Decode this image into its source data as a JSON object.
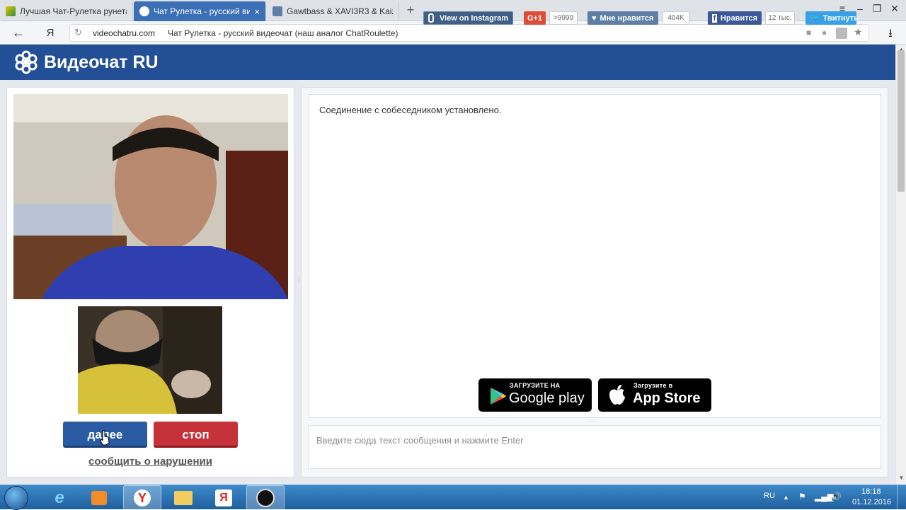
{
  "browser": {
    "tabs": [
      {
        "label": "Лучшая Чат-Рулетка рунета",
        "active": false
      },
      {
        "label": "Чат Рулетка - русский видеочат",
        "active": true
      },
      {
        "label": "Gawtbass & XAVI3R3 & Kaiz",
        "active": false
      }
    ],
    "tab_close": "×",
    "new_tab": "+",
    "address": {
      "domain": "videochatru.com",
      "page_title": "Чат Рулетка - русский видеочат (наш аналог ChatRoulette)"
    }
  },
  "site": {
    "logo_text": "Видеочат RU",
    "social": {
      "instagram": "View on Instagram",
      "gplus": "G+1",
      "gplus_count": ">9999",
      "like": "Мне нравится",
      "like_count": "404K",
      "facebook": "Нравится",
      "facebook_count": "12 тыс.",
      "twitter": "Твитнуть"
    },
    "buttons": {
      "next": "далее",
      "stop": "стоп"
    },
    "report_link": "сообщить о нарушении",
    "chat": {
      "status_message": "Соединение с собеседником установлено.",
      "input_placeholder": "Введите сюда текст сообщения и нажмите Enter"
    },
    "stores": {
      "google_small": "ЗАГРУЗИТЕ НА",
      "google_big": "Google play",
      "apple_small": "Загрузите в",
      "apple_big": "App Store"
    }
  },
  "taskbar": {
    "language": "RU",
    "time": "18:18",
    "date": "01.12.2016",
    "yandex_letter": "Я"
  },
  "colors": {
    "header": "#234f96",
    "next_button": "#2a5aa2",
    "stop_button": "#c5323a"
  }
}
